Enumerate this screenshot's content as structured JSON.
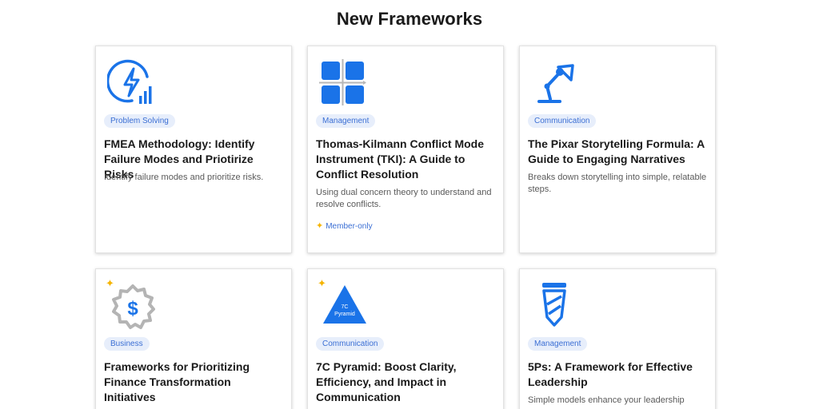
{
  "page": {
    "title": "New Frameworks"
  },
  "colors": {
    "accent": "#1a73e8",
    "tag_bg": "#e7eefb",
    "tag_text": "#3b6fd4",
    "sparkle": "#f5b400"
  },
  "cards": [
    {
      "icon": "lightning-chart-icon",
      "tag": "Problem Solving",
      "title": "FMEA Methodology: Identify Failure Modes and Priotirize Risks",
      "description": "Identify failure modes and prioritize risks.",
      "member": ""
    },
    {
      "icon": "quadrant-grid-icon",
      "tag": "Management",
      "title": "Thomas-Kilmann Conflict Mode Instrument (TKI): A Guide to Conflict Resolution",
      "description": "Using dual concern theory to understand and resolve conflicts.",
      "member": "Member-only"
    },
    {
      "icon": "desk-lamp-icon",
      "tag": "Communication",
      "title": "The Pixar Storytelling Formula: A Guide to Engaging Narratives",
      "description": "Breaks down storytelling into simple, relatable steps.",
      "member": ""
    },
    {
      "icon": "dollar-badge-icon",
      "tag": "Business",
      "title": "Frameworks for Prioritizing Finance Transformation Initiatives",
      "description": "",
      "member": ""
    },
    {
      "icon": "pyramid-icon",
      "icon_text_1": "7C",
      "icon_text_2": "Pyramid",
      "tag": "Communication",
      "title": "7C Pyramid: Boost Clarity, Efficiency, and Impact in Communication",
      "description": "",
      "member": ""
    },
    {
      "icon": "tie-icon",
      "tag": "Management",
      "title": "5Ps: A Framework for Effective Leadership",
      "description": "Simple models enhance your leadership",
      "member": ""
    }
  ]
}
